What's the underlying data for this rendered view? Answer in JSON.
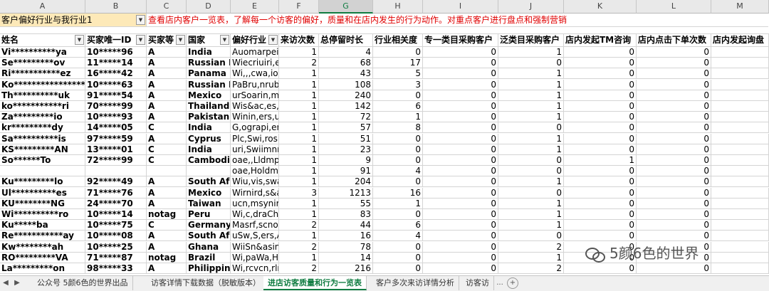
{
  "columns": [
    "A",
    "B",
    "C",
    "D",
    "E",
    "F",
    "G",
    "H",
    "I",
    "J",
    "K",
    "L",
    "M"
  ],
  "selected_column": "G",
  "row1": {
    "filter_label": "客户偏好行业与我行业1",
    "note": "查看店内客户一览表，了解每一个访客的偏好，质量和在店内发生的行为动作。对重点客户进行盘点和强制营销"
  },
  "headers": [
    "姓名",
    "买家唯一ID",
    "买家等",
    "国家",
    "偏好行业",
    "来访次数",
    "总停留时长",
    "行业相关度",
    "专一类目采购客户",
    "泛类目采购客户",
    "店内发起TM咨询",
    "店内点击下单次数",
    "店内发起询盘"
  ],
  "rows": [
    [
      "Vi**********ya",
      "10*****96",
      "A",
      "India",
      "Auomarpeir",
      "1",
      "4",
      "0",
      "0",
      "1",
      "0",
      "0"
    ],
    [
      "Se*********ov",
      "11*****14",
      "A",
      "Russian Fed",
      "Wiecriuiri,ers",
      "2",
      "68",
      "17",
      "0",
      "0",
      "0",
      "0"
    ],
    [
      "Ri***********ez",
      "16*****42",
      "A",
      "Panama",
      "Wi,,,cwa,ioe",
      "1",
      "43",
      "5",
      "0",
      "1",
      "0",
      "0"
    ],
    [
      "Ko****************ev",
      "10*****63",
      "A",
      "Russian Fed",
      "PaBru,nrub,p",
      "1",
      "108",
      "3",
      "0",
      "1",
      "0",
      "0"
    ],
    [
      "Th**********uk",
      "91*****54",
      "A",
      "Mexico",
      "urSoarin,ma",
      "1",
      "240",
      "0",
      "0",
      "1",
      "0",
      "0"
    ],
    [
      "ko***********ri",
      "70*****99",
      "A",
      "Thailand",
      "Wis&ac,es,L",
      "1",
      "142",
      "6",
      "0",
      "1",
      "0",
      "0"
    ],
    [
      "Za*********io",
      "10*****93",
      "A",
      "Pakistan",
      "Winin,ers,uri",
      "1",
      "72",
      "1",
      "0",
      "1",
      "0",
      "0"
    ],
    [
      "kr*********dy",
      "14*****05",
      "C",
      "India",
      "G,ograpi,ers",
      "1",
      "57",
      "8",
      "0",
      "0",
      "0",
      "0"
    ],
    [
      "Sa**********is",
      "97*****59",
      "A",
      "Cyprus",
      "Plc,Swi,rosru",
      "1",
      "51",
      "0",
      "0",
      "1",
      "0",
      "0"
    ],
    [
      "KS*********AN",
      "13*****01",
      "C",
      "India",
      "uri,Swiimnni",
      "1",
      "23",
      "0",
      "0",
      "1",
      "0",
      "0"
    ],
    [
      "So******To",
      "72*****99",
      "C",
      "Cambodia",
      "oae,,LldmpE",
      "1",
      "9",
      "0",
      "0",
      "0",
      "1",
      "0"
    ],
    [
      "",
      "",
      "",
      "",
      "oae,Holdmp",
      "1",
      "91",
      "4",
      "0",
      "0",
      "0",
      "0"
    ],
    [
      "Ku*********lo",
      "92*****49",
      "A",
      "South Afric",
      "Wiu,vis,swa,i",
      "1",
      "204",
      "0",
      "0",
      "1",
      "0",
      "0"
    ],
    [
      "Ul**********es",
      "71*****76",
      "A",
      "Mexico",
      "Wirnird,s&ac",
      "3",
      "1213",
      "16",
      "0",
      "0",
      "0",
      "0"
    ],
    [
      "KU********NG",
      "24*****70",
      "A",
      "Taiwan",
      "ucn,msynirin",
      "1",
      "55",
      "1",
      "0",
      "1",
      "0",
      "0"
    ],
    [
      "Wi**********ro",
      "10*****14",
      "notag",
      "Peru",
      "Wi,c,draChe",
      "1",
      "83",
      "0",
      "0",
      "1",
      "0",
      "0"
    ],
    [
      "Ku*****ba",
      "10*****75",
      "C",
      "Germany",
      "Masrf,scnoc",
      "2",
      "44",
      "6",
      "0",
      "1",
      "0",
      "0"
    ],
    [
      "Re***********ay",
      "10*****08",
      "A",
      "South Afric",
      "uSw,S,ers,Al,",
      "1",
      "16",
      "4",
      "0",
      "0",
      "0",
      "0"
    ],
    [
      "Kw********ah",
      "10*****25",
      "A",
      "Ghana",
      "WiiSn&asinr",
      "2",
      "78",
      "0",
      "0",
      "2",
      "0",
      "0"
    ],
    [
      "RO*********VA",
      "71*****87",
      "notag",
      "Brazil",
      "Wi,paWa,Hu",
      "1",
      "14",
      "0",
      "0",
      "1",
      "0",
      "0"
    ],
    [
      "La*********on",
      "98*****33",
      "A",
      "Philippines",
      "Wi,rcvcn,rlm",
      "2",
      "216",
      "0",
      "0",
      "2",
      "0",
      "0"
    ]
  ],
  "tabs": [
    "公众号 5颜6色的世界出品",
    "访客详情下载数据（脱敏版本）",
    "进店访客质量和行为一览表",
    "客户多次来访详情分析",
    "访客访"
  ],
  "active_tab": "进店访客质量和行为一览表",
  "nav": {
    "prev": "◀",
    "next": "▶",
    "more": "...",
    "add": "+"
  },
  "watermark": "5颜6色的世界"
}
